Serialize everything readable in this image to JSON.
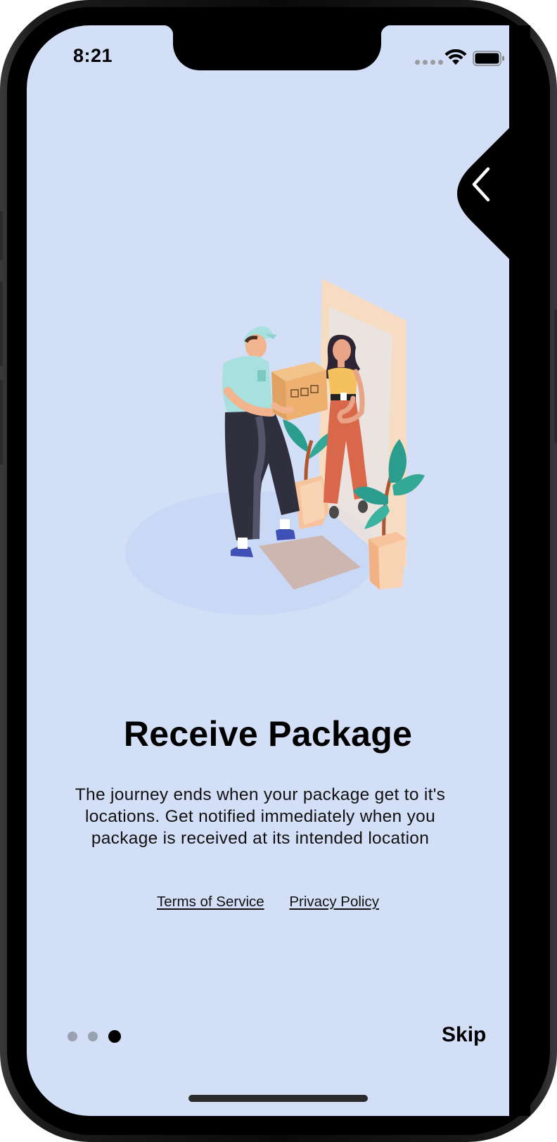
{
  "status_bar": {
    "time": "8:21"
  },
  "navigation": {
    "back_icon": "chevron-left-icon"
  },
  "onboarding": {
    "title": "Receive Package",
    "description": "The journey ends when your package get to it's locations. Get notified immediately when you package is received at its intended location",
    "illustration": "courier-delivering-box-illustration",
    "links": {
      "terms": "Terms of Service",
      "privacy": "Privacy Policy"
    },
    "pager": {
      "total_pages": 3,
      "current_page": 3
    },
    "skip_label": "Skip"
  },
  "colors": {
    "background": "#d3dff7",
    "text": "#000000",
    "inactive_dot": "#9aa1b0",
    "active_dot": "#000000"
  }
}
